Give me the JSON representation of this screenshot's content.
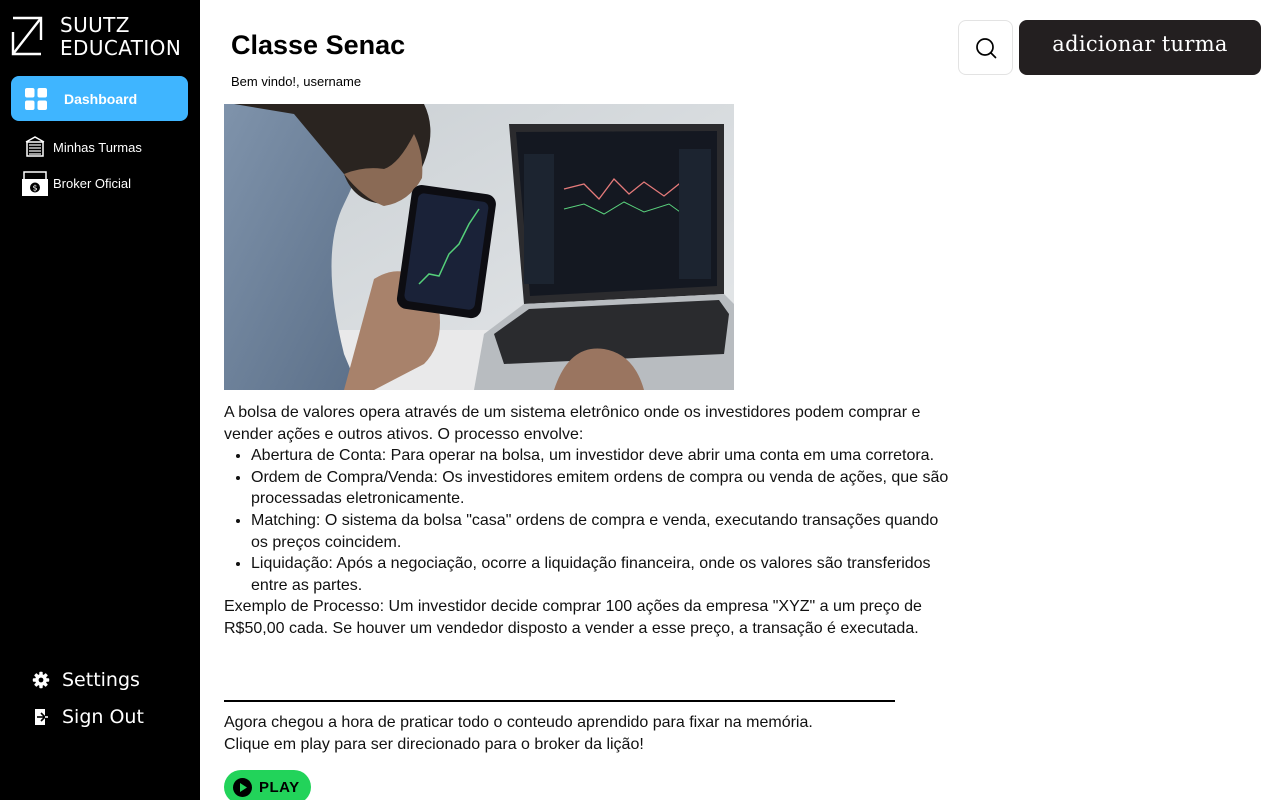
{
  "brand": {
    "line1": "SUUTZ",
    "line2": "EDUCATION"
  },
  "sidebar": {
    "active": {
      "label": "Dashboard",
      "icon": "grid-icon"
    },
    "items": [
      {
        "label": "Minhas Turmas",
        "icon": "classroom-icon"
      },
      {
        "label": "Broker Oficial",
        "icon": "money-icon"
      }
    ],
    "bottom": [
      {
        "label": "Settings",
        "icon": "gear-icon"
      },
      {
        "label": "Sign Out",
        "icon": "sign-out-icon"
      }
    ]
  },
  "header": {
    "title": "Classe Senac",
    "subtitle": "Bem vindo!, username",
    "search_icon": "search-icon",
    "add_button": "adicionar turma"
  },
  "lesson": {
    "intro": "A bolsa de valores opera através de um sistema eletrônico onde os investidores podem comprar e vender ações e outros ativos. O processo envolve:",
    "steps": [
      "Abertura de Conta: Para operar na bolsa, um investidor deve abrir uma conta em uma corretora.",
      "Ordem de Compra/Venda: Os investidores emitem ordens de compra ou venda de ações, que são processadas eletronicamente.",
      "Matching: O sistema da bolsa \"casa\" ordens de compra e venda, executando transações quando os preços coincidem.",
      "Liquidação: Após a negociação, ocorre a liquidação financeira, onde os valores são transferidos entre as partes."
    ],
    "example": "Exemplo de Processo: Um investidor decide comprar 100 ações da empresa \"XYZ\" a um preço de R$50,00 cada. Se houver um vendedor disposto a vender a esse preço, a transação é executada.",
    "practice_line1": "Agora chegou a hora de praticar todo o conteudo aprendido para fixar na memória.",
    "practice_line2": "Clique em play para ser direcionado para o broker da lição!",
    "play_label": "PLAY"
  },
  "colors": {
    "sidebar_bg": "#000000",
    "active_nav": "#3fb5ff",
    "add_button_bg": "#231f20",
    "play_green": "#22d35a"
  }
}
